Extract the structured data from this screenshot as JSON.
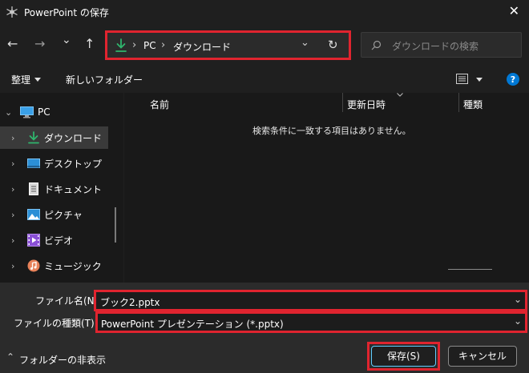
{
  "window": {
    "title": "PowerPoint の保存",
    "close_glyph": "✕"
  },
  "nav": {
    "back_glyph": "←",
    "forward_glyph": "→",
    "dropdown_glyph": "⌄",
    "up_glyph": "↑",
    "path": [
      "PC",
      "ダウンロード"
    ],
    "sep_glyph": "›",
    "refresh_glyph": "↻",
    "search_placeholder": "ダウンロードの検索"
  },
  "toolbar": {
    "organize_label": "整理",
    "new_folder_label": "新しいフォルダー"
  },
  "sidebar": {
    "root": {
      "label": "PC",
      "icon": "pc-icon"
    },
    "items": [
      {
        "label": "ダウンロード",
        "icon": "download-icon",
        "selected": true
      },
      {
        "label": "デスクトップ",
        "icon": "desktop-icon"
      },
      {
        "label": "ドキュメント",
        "icon": "document-icon"
      },
      {
        "label": "ピクチャ",
        "icon": "pictures-icon"
      },
      {
        "label": "ビデオ",
        "icon": "video-icon"
      },
      {
        "label": "ミュージック",
        "icon": "music-icon"
      }
    ]
  },
  "list": {
    "columns": [
      "名前",
      "更新日時",
      "種類"
    ],
    "empty_message": "検索条件に一致する項目はありません。"
  },
  "form": {
    "filename_label": "ファイル名(N):",
    "filename_value": "ブック2.pptx",
    "filetype_label": "ファイルの種類(T):",
    "filetype_value": "PowerPoint プレゼンテーション (*.pptx)"
  },
  "footer": {
    "hide_folders_label": "フォルダーの非表示",
    "save_label": "保存(S)",
    "cancel_label": "キャンセル"
  },
  "colors": {
    "highlight": "#e0242f",
    "accent": "#0078d4",
    "download_green": "#2fb56d"
  }
}
